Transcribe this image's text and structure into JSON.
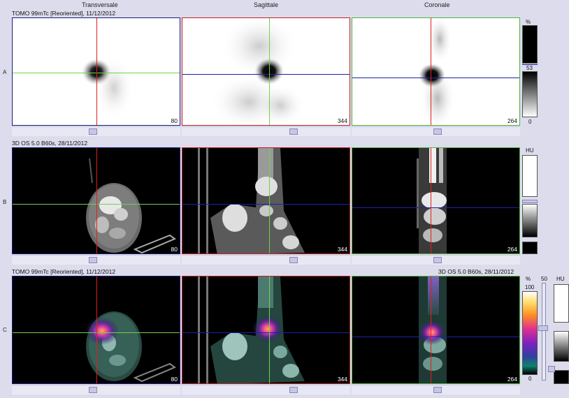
{
  "columns": {
    "transversale": "Transversale",
    "sagittale": "Sagittale",
    "coronale": "Coronale"
  },
  "rows": {
    "a": {
      "label": "A",
      "info": "TOMO 99mTc [Reoriented], 11/12/2012"
    },
    "b": {
      "label": "B",
      "info": "3D  OS  5.0  B60s, 28/11/2012"
    },
    "c": {
      "label": "C",
      "info": "TOMO 99mTc [Reoriented], 11/12/2012",
      "info_right": "3D  OS  5.0  B60s, 28/11/2012"
    }
  },
  "slice_numbers": {
    "trans": "80",
    "sag": "344",
    "cor": "264"
  },
  "scales": {
    "a": {
      "unit": "%",
      "value": "53",
      "min": "0"
    },
    "b": {
      "unit": "HU"
    },
    "c": {
      "unit": "%",
      "max": "100",
      "min": "0",
      "value": "50",
      "unit2": "HU"
    }
  },
  "colors": {
    "crosshair_red": "#e02020",
    "crosshair_green": "#6cd44c",
    "crosshair_blue": "#2020b0",
    "frame_trans": "#1a1a80",
    "frame_sag": "#c02020",
    "frame_cor": "#4cb43c"
  }
}
